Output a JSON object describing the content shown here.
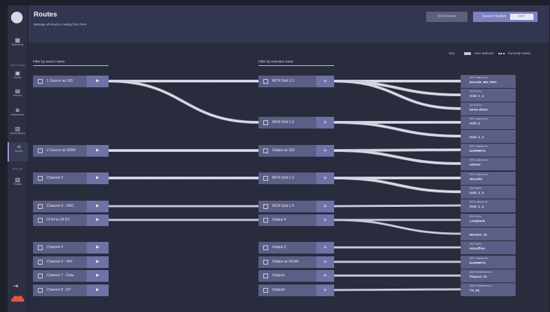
{
  "sidebar": {
    "items": [
      {
        "icon": "▦",
        "label": "Dashboard"
      },
      {
        "icon": "▣",
        "label": "Events"
      },
      {
        "icon": "▤",
        "label": "Sources"
      },
      {
        "icon": "⊗",
        "label": "Subscribers"
      },
      {
        "icon": "▥",
        "label": "Subscriptions"
      },
      {
        "icon": "≺",
        "label": "Routes"
      },
      {
        "icon": "▧",
        "label": "Profiles"
      }
    ],
    "section_connect": "NDIX Connect",
    "section_live": "NDIX Live",
    "logout_icon": "⇥"
  },
  "header": {
    "title": "Routes",
    "subtitle": "Manage all source routing from here",
    "multiviewer": "Multiviewer",
    "source_switch": "Source Switch",
    "toggle_state": "OFF"
  },
  "key": {
    "label": "Key:",
    "user_selected": "User selected",
    "currently_routed": "Currently routed"
  },
  "filters": {
    "sources": "Filter by source name",
    "selections": "Filter by selection name"
  },
  "sources": [
    "1 Source as SDI",
    "2 Source as 5994i",
    "Channel 3",
    "Channel 9 - OBC",
    "FF04 to 29 97i",
    "Channel 4",
    "Channel 6 - WIF",
    "Channel 7 - Data",
    "Channel 8 - DT"
  ],
  "selections": [
    "MCR Grid 1.1",
    "MCR Grid 1.2",
    "Output as SDI",
    "MCR Grid 1.3",
    "MCR Grid 1.4",
    "Output 4",
    "Output 3",
    "Output as 59.94i",
    "Output1",
    "Output2"
  ],
  "outputs": [
    {
      "line1": "SRT Listener to",
      "line2": "Encode_BH_FRA"
    },
    {
      "line1": "Zixi Pull to",
      "line2": "Grid_1_1"
    },
    {
      "line1": "Zixi Pull to",
      "line2": "kevin-demo"
    },
    {
      "line1": "SRT Listener to",
      "line2": "Grid_2"
    },
    {
      "line1": "",
      "line2": "Grid_1_2"
    },
    {
      "line1": "SRT Listener to",
      "line2": "DCRRRT4"
    },
    {
      "line1": "SRT Listener to",
      "line2": "mbtest"
    },
    {
      "line1": "SRT Listener to",
      "line2": "decoder"
    },
    {
      "line1": "Zixi Pull to",
      "line2": "Grid_1_3"
    },
    {
      "line1": "SRT Listener to",
      "line2": "Grid_1_4"
    },
    {
      "line1": "Zixi Pull to",
      "line2": "Loopback"
    },
    {
      "line1": "",
      "line2": "Monitor_01"
    },
    {
      "line1": "Zixi Pull to",
      "line2": "m2scffice"
    },
    {
      "line1": "SRT Listener to",
      "line2": "DCRRRT3"
    },
    {
      "line1": "AWS Entitlement to",
      "line2": "Playout_01"
    },
    {
      "line1": "AWS Entitlement to",
      "line2": "TX_04"
    }
  ],
  "colors": {
    "accent": "#7c80c0",
    "routed": "#e6e7f0",
    "user_selected": "#c9cad7"
  }
}
